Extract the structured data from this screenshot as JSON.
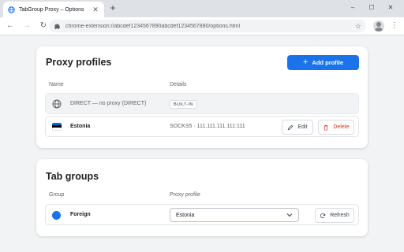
{
  "browser": {
    "tab_title": "TabGroup Proxy – Options",
    "tab_close": "✕",
    "new_tab": "+",
    "url": "chrome-extension://abcdef1234567890abcdef1234567890/options.html",
    "window_controls": {
      "minimize": "–",
      "maximize": "☐",
      "close": "✕"
    },
    "nav": {
      "back": "←",
      "forward": "→",
      "reload": "↻"
    },
    "star": "☆",
    "menu": "⋮"
  },
  "profiles": {
    "title": "Proxy profiles",
    "add_label": "Add profile",
    "add_icon": "+",
    "headers": {
      "name": "Name",
      "details": "Details"
    },
    "rows": [
      {
        "icon": "globe-icon",
        "name": "DIRECT — no proxy (DIRECT)",
        "badge": "BUILT-IN"
      },
      {
        "icon": "estonia-flag-icon",
        "name": "Estonia",
        "details": "SOCKS5 · 111.111.111.111:111",
        "edit_label": "Edit",
        "delete_label": "Delete"
      }
    ]
  },
  "groups": {
    "title": "Tab groups",
    "headers": {
      "group": "Group",
      "profile": "Proxy profile"
    },
    "rows": [
      {
        "color": "#1a73e8",
        "name": "Foreign",
        "selected_profile": "Estonia",
        "refresh_label": "Refresh"
      }
    ]
  },
  "colors": {
    "accent": "#1a73e8",
    "danger": "#d93025",
    "flag_blue": "#0072ce",
    "flag_black": "#000000",
    "flag_white": "#ffffff"
  }
}
